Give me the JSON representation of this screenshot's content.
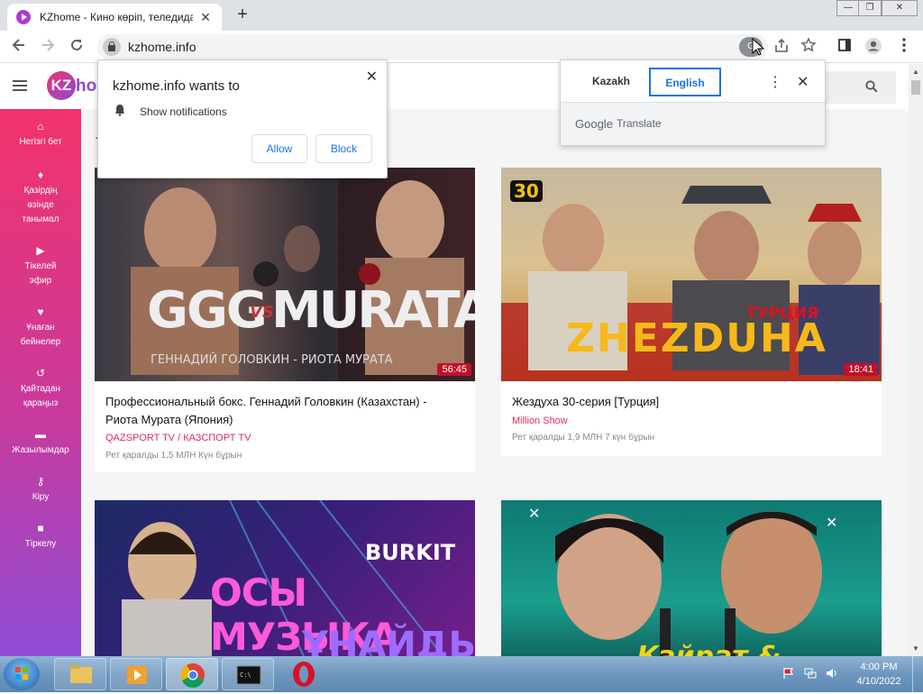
{
  "browser": {
    "tab_title": "KZhome - Кино көріп, теледидар",
    "tab_close": "✕",
    "new_tab": "+",
    "url": "kzhome.info",
    "window_buttons": [
      "—",
      "❐",
      "✕"
    ],
    "translate_icon_label": "G"
  },
  "site": {
    "logo_short": "KZ",
    "logo_rest": "ho",
    "sidebar": [
      {
        "icon": "home-icon",
        "glyph": "⌂",
        "label": "Негізгі бет"
      },
      {
        "icon": "fire-icon",
        "glyph": "♦",
        "label": "Қазірдің өзінде танымал"
      },
      {
        "icon": "youtube-icon",
        "glyph": "▶",
        "label": "Тікелей эфир"
      },
      {
        "icon": "heart-icon",
        "glyph": "♥",
        "label": "Ұнаған бейнелер"
      },
      {
        "icon": "history-icon",
        "glyph": "↺",
        "label": "Қайтадан қараңыз"
      },
      {
        "icon": "folder-icon",
        "glyph": "▬",
        "label": "Жазылымдар"
      },
      {
        "icon": "key-icon",
        "glyph": "⚷",
        "label": "Кіру"
      },
      {
        "icon": "lock-icon",
        "glyph": "■",
        "label": "Тіркелу"
      }
    ],
    "section_letter": "Т",
    "videos": [
      {
        "title": "Профессиональный бокс. Геннадий Головкин (Казахстан) - Риота Мурата (Япония)",
        "channel": "QAZSPORT TV / КАЗСПОРТ TV",
        "meta": "Рет қаралды 1,5 МЛН   Күн бұрын",
        "duration": "56:45",
        "overlay": "GGG",
        "overlay_vs": "VS",
        "overlay2": "MURATA",
        "overlay_sub": "ГЕННАДИЙ ГОЛОВКИН - РИОТА МУРАТА"
      },
      {
        "title": "Жездуха 30-серия [Турция]",
        "channel": "Million Show",
        "meta": "Рет қаралды 1,9 МЛН   7 күн бұрын",
        "duration": "18:41",
        "overlay": "ZHEZDUHA",
        "overlay_tag": "ТУРЦИЯ",
        "overlay_num": "30"
      },
      {
        "overlay": "BURKIT",
        "overlay2": "ОСЫ МУЗЫКА",
        "overlay3": "ҰНАЙДЫ"
      },
      {
        "overlay": "Қайрат & Режиссер"
      }
    ]
  },
  "notification_prompt": {
    "title": "kzhome.info wants to",
    "permission": "Show notifications",
    "allow": "Allow",
    "block": "Block",
    "close": "✕"
  },
  "translate_popup": {
    "lang_source": "Kazakh",
    "lang_target": "English",
    "brand": "Google",
    "brand_suffix": "Translate",
    "more": "⋮",
    "close": "✕"
  },
  "taskbar": {
    "time": "4:00 PM",
    "date": "4/10/2022"
  }
}
